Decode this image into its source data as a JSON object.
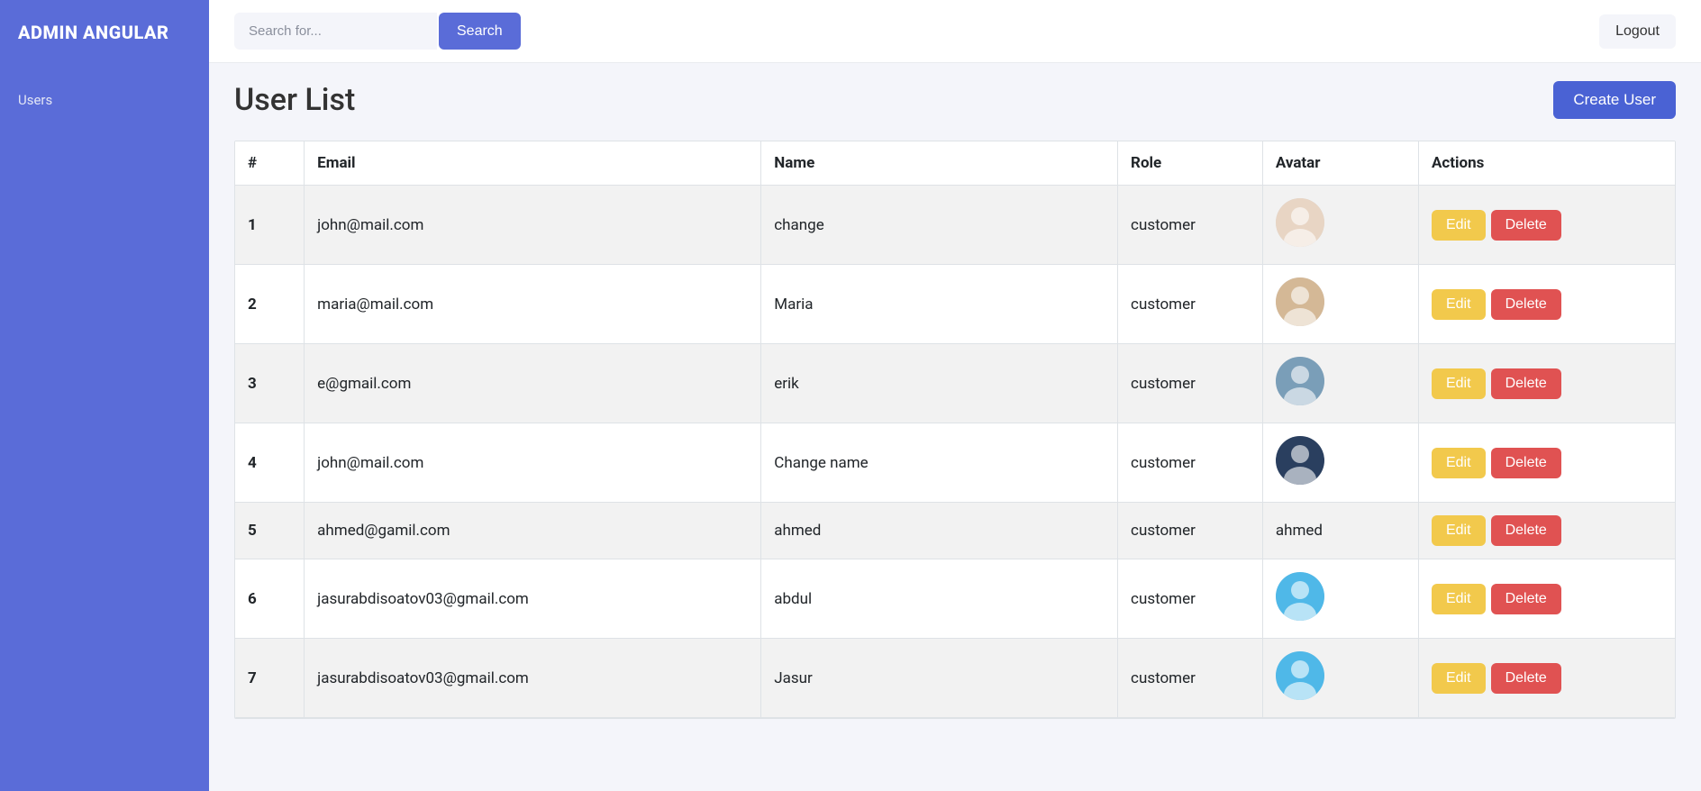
{
  "brand": "ADMIN ANGULAR",
  "sidebar": {
    "items": [
      {
        "label": "Users"
      }
    ]
  },
  "topbar": {
    "search_placeholder": "Search for...",
    "search_button": "Search",
    "logout": "Logout"
  },
  "page": {
    "title": "User List",
    "create_button": "Create User"
  },
  "table": {
    "headers": {
      "num": "#",
      "email": "Email",
      "name": "Name",
      "role": "Role",
      "avatar": "Avatar",
      "actions": "Actions"
    },
    "edit_label": "Edit",
    "delete_label": "Delete",
    "rows": [
      {
        "num": "1",
        "email": "john@mail.com",
        "name": "change",
        "role": "customer",
        "avatar_type": "image",
        "avatar_bg": "#e8d5c4"
      },
      {
        "num": "2",
        "email": "maria@mail.com",
        "name": "Maria",
        "role": "customer",
        "avatar_type": "image",
        "avatar_bg": "#d4b896"
      },
      {
        "num": "3",
        "email": "e@gmail.com",
        "name": "erik",
        "role": "customer",
        "avatar_type": "image",
        "avatar_bg": "#7a9eb8"
      },
      {
        "num": "4",
        "email": "john@mail.com",
        "name": "Change name",
        "role": "customer",
        "avatar_type": "image",
        "avatar_bg": "#2a3f5f"
      },
      {
        "num": "5",
        "email": "ahmed@gamil.com",
        "name": "ahmed",
        "role": "customer",
        "avatar_type": "text",
        "avatar_text": "ahmed"
      },
      {
        "num": "6",
        "email": "jasurabdisoatov03@gmail.com",
        "name": "abdul",
        "role": "customer",
        "avatar_type": "image",
        "avatar_bg": "#4fb8e8"
      },
      {
        "num": "7",
        "email": "jasurabdisoatov03@gmail.com",
        "name": "Jasur",
        "role": "customer",
        "avatar_type": "image",
        "avatar_bg": "#4fb8e8"
      }
    ]
  }
}
